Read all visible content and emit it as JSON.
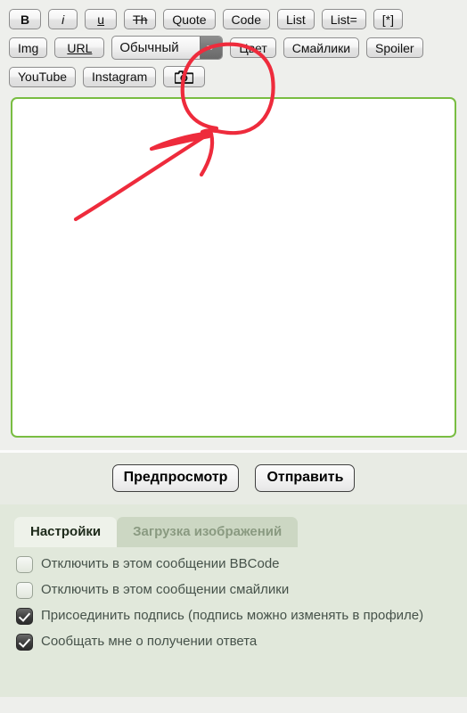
{
  "toolbar": {
    "rows": [
      [
        {
          "label": "B",
          "name": "bold-button",
          "style": "b"
        },
        {
          "label": "i",
          "name": "italic-button",
          "style": "i"
        },
        {
          "label": "u",
          "name": "underline-button",
          "style": "u"
        },
        {
          "label": "Th",
          "name": "strikethrough-button",
          "style": "s"
        },
        {
          "label": "Quote",
          "name": "quote-button",
          "style": ""
        },
        {
          "label": "Code",
          "name": "code-button",
          "style": ""
        },
        {
          "label": "List",
          "name": "list-button",
          "style": ""
        },
        {
          "label": "List=",
          "name": "list-ordered-button",
          "style": ""
        },
        {
          "label": "[*]",
          "name": "list-item-button",
          "style": ""
        }
      ],
      [
        {
          "label": "Img",
          "name": "image-button",
          "style": ""
        },
        {
          "label": "URL",
          "name": "url-button",
          "style": "u"
        },
        {
          "label": "Цвет",
          "name": "color-button",
          "style": ""
        },
        {
          "label": "Смайлики",
          "name": "smilies-button",
          "style": ""
        },
        {
          "label": "Spoiler",
          "name": "spoiler-button",
          "style": ""
        }
      ],
      [
        {
          "label": "YouTube",
          "name": "youtube-button",
          "style": ""
        },
        {
          "label": "Instagram",
          "name": "instagram-button",
          "style": ""
        }
      ]
    ],
    "font_select": {
      "value": "Обычный",
      "options": [
        "Обычный"
      ]
    },
    "camera_button_icon": "camera-icon"
  },
  "editor": {
    "value": "",
    "placeholder": ""
  },
  "actions": {
    "preview_label": "Предпросмотр",
    "submit_label": "Отправить"
  },
  "tabs": [
    {
      "label": "Настройки",
      "active": true
    },
    {
      "label": "Загрузка изображений",
      "active": false
    }
  ],
  "settings": {
    "checkboxes": [
      {
        "label": "Отключить в этом сообщении BBCode",
        "checked": false
      },
      {
        "label": "Отключить в этом сообщении смайлики",
        "checked": false
      },
      {
        "label": "Присоединить подпись (подпись можно изменять в профиле)",
        "checked": true
      },
      {
        "label": "Сообщать мне о получении ответа",
        "checked": true
      }
    ]
  },
  "annotation": {
    "color": "#ee2b3c",
    "shapes": [
      "oval-highlight-around-camera-button",
      "arrow-pointing-to-camera-button"
    ]
  },
  "colors": {
    "editor_border": "#79bd42",
    "panel_background": "#e1e8db",
    "page_background": "#eeefec",
    "annotation_red": "#ee2b3c"
  }
}
